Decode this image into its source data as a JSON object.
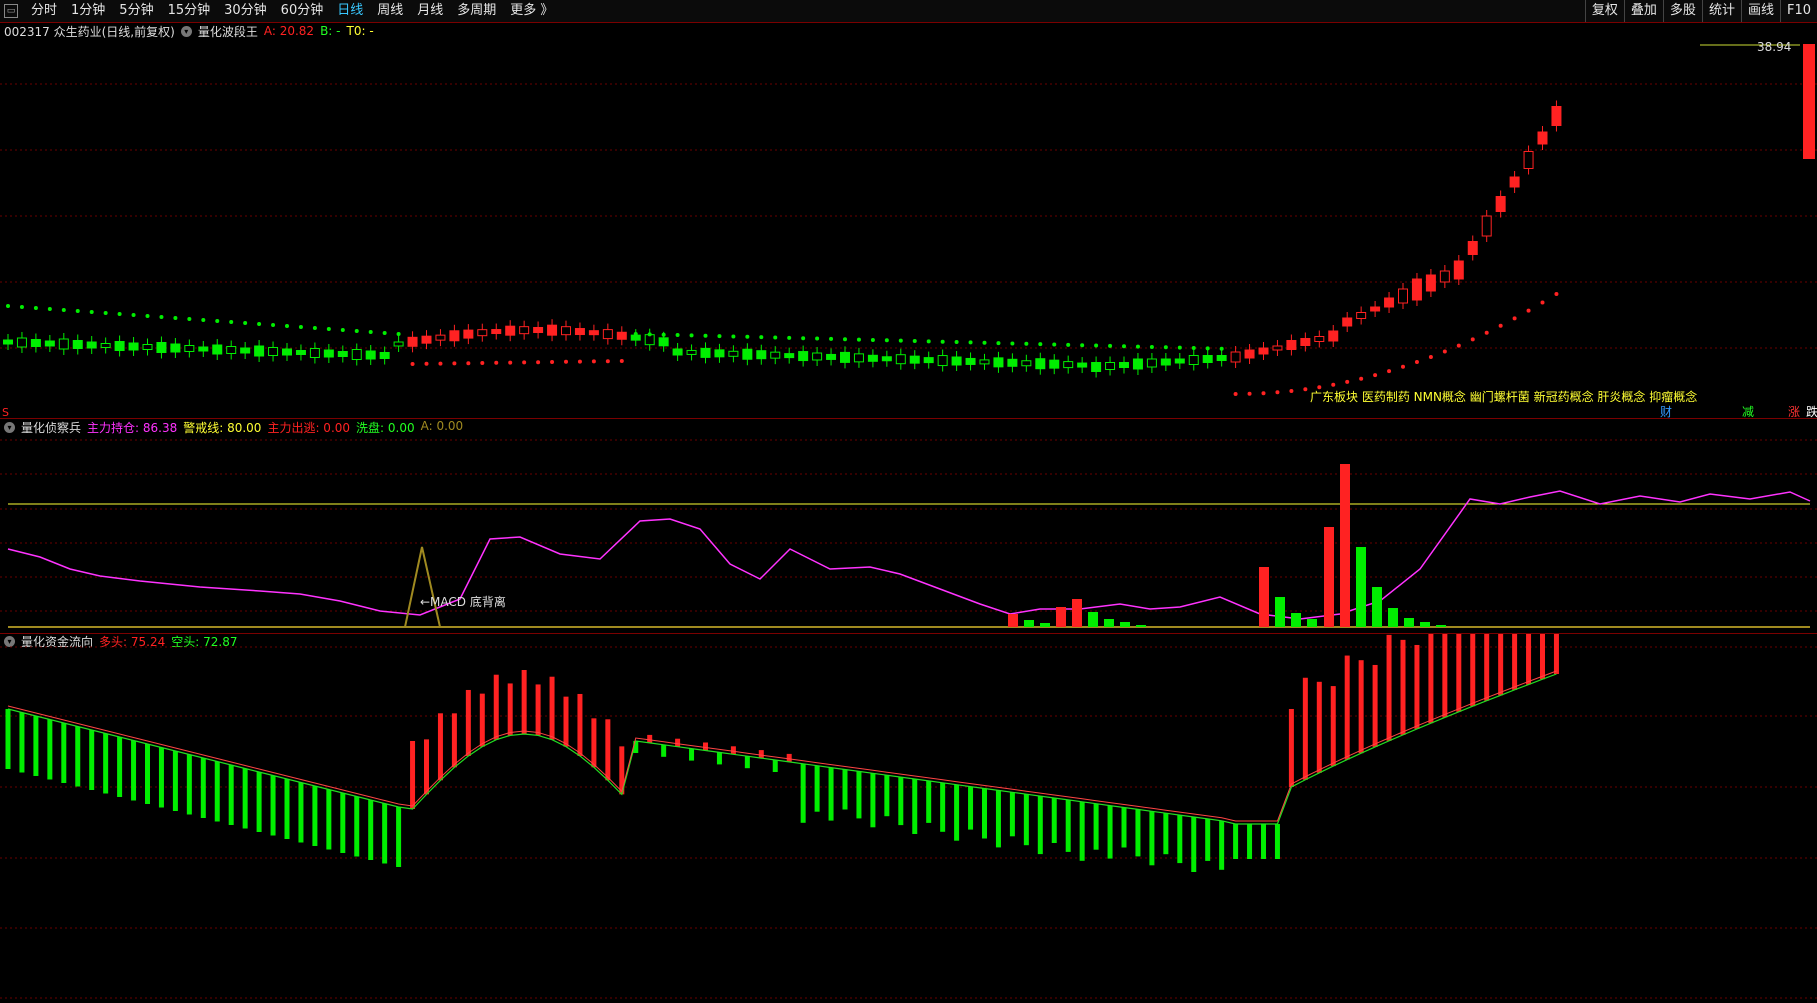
{
  "toolbar": {
    "menu_icon": "window-menu-icon",
    "periods": [
      "分时",
      "1分钟",
      "5分钟",
      "15分钟",
      "30分钟",
      "60分钟",
      "日线",
      "周线",
      "月线",
      "多周期",
      "更多 》"
    ],
    "active_period": "日线",
    "right_buttons": [
      "复权",
      "叠加",
      "多股",
      "统计",
      "画线",
      "F10"
    ]
  },
  "main": {
    "stock": "002317 众生药业(日线,前复权)",
    "indicator": "量化波段王",
    "a_label": "A:",
    "a_value": "20.82",
    "b_label": "B:",
    "b_value": "-",
    "t0_label": "T0:",
    "t0_value": "-",
    "high_price": "38.94",
    "concepts": "广东板块 医药制药 NMN概念 幽门螺杆菌 新冠药概念 肝炎概念 抑瘤概念",
    "marker_left": "S",
    "tags": [
      "财",
      "减",
      "涨",
      "跌"
    ]
  },
  "panel2": {
    "name": "量化侦察兵",
    "items": [
      {
        "label": "主力持仓:",
        "value": "86.38",
        "color": "#ff33ff"
      },
      {
        "label": "警戒线:",
        "value": "80.00",
        "color": "#ffff33"
      },
      {
        "label": "主力出逃:",
        "value": "0.00",
        "color": "#ff2222"
      },
      {
        "label": "洗盘:",
        "value": "0.00",
        "color": "#22ff22"
      },
      {
        "label": "A:",
        "value": "0.00",
        "color": "#a08a20"
      }
    ],
    "annotation": "←MACD 底背离"
  },
  "panel3": {
    "name": "量化资金流向",
    "bull_label": "多头:",
    "bull_value": "75.24",
    "bear_label": "空头:",
    "bear_value": "72.87"
  },
  "colors": {
    "up": "#ff2222",
    "down": "#00ee00",
    "line": "#ff33ff",
    "warn": "#ffff33",
    "grid": "#7a0000"
  }
}
